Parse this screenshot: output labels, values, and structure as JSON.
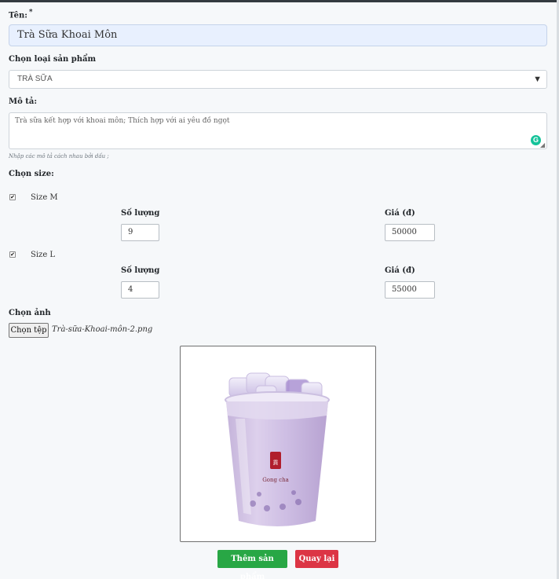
{
  "form": {
    "name_label": "Tên:",
    "name_required_mark": "*",
    "name_value": "Trà Sữa Khoai Môn",
    "category_label": "Chọn loại sản phẩm",
    "category_value": "TRÀ SỮA",
    "description_label": "Mô tả:",
    "description_value": "Trà sữa kết hợp với khoai môn; Thích hợp với ai yêu đồ ngọt",
    "description_hint": "Nhập các mô tả cách nhau bởi dấu ;",
    "size_label": "Chọn size:",
    "sizes": [
      {
        "label": "Size M",
        "checked": true,
        "qty_label": "Số lượng",
        "qty": "9",
        "price_label": "Giá (đ)",
        "price": "50000"
      },
      {
        "label": "Size L",
        "checked": true,
        "qty_label": "Số lượng",
        "qty": "4",
        "price_label": "Giá (đ)",
        "price": "55000"
      }
    ],
    "image_label": "Chọn ảnh",
    "file_button": "Chọn tệp",
    "file_name": "Trà-sữa-Khoai-môn-2.png",
    "cup_logo_text": "Gong cha",
    "submit_button": "Thêm sản phẩm",
    "back_button": "Quay lại"
  },
  "icons": {
    "dropdown": "chevron-down-icon",
    "grammarly": "grammarly-icon",
    "checkbox_mark": "✔"
  },
  "colors": {
    "name_bg": "#e8f0fe",
    "submit": "#28a745",
    "back": "#dc3545",
    "grammarly": "#15c39a"
  }
}
